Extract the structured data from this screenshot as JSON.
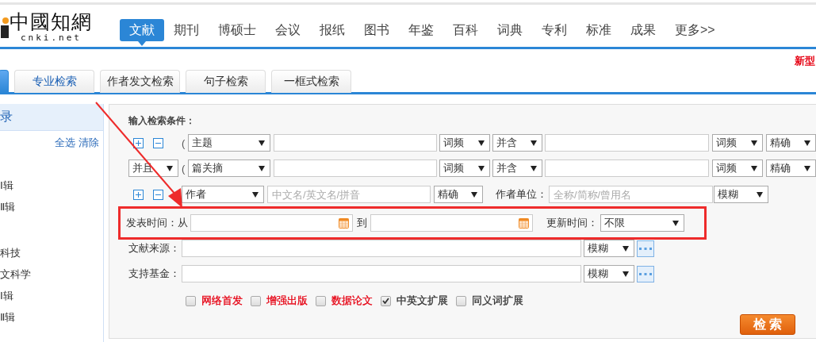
{
  "logo": {
    "text": "中國知網",
    "domain": "cnki.net"
  },
  "nav": [
    {
      "label": "文献",
      "selected": true
    },
    {
      "label": "期刊",
      "selected": false
    },
    {
      "label": "博硕士",
      "selected": false
    },
    {
      "label": "会议",
      "selected": false
    },
    {
      "label": "报纸",
      "selected": false
    },
    {
      "label": "图书",
      "selected": false
    },
    {
      "label": "年鉴",
      "selected": false
    },
    {
      "label": "百科",
      "selected": false
    },
    {
      "label": "词典",
      "selected": false
    },
    {
      "label": "专利",
      "selected": false
    },
    {
      "label": "标准",
      "selected": false
    },
    {
      "label": "成果",
      "selected": false
    },
    {
      "label": "更多>>",
      "selected": false
    }
  ],
  "top_right_link": "新型",
  "search_tabs": [
    {
      "selected": true
    },
    {
      "label": "专业检索",
      "selected": false
    },
    {
      "label": "作者发文检索",
      "selected": false
    },
    {
      "label": "句子检索",
      "selected": false
    },
    {
      "label": "一框式检索",
      "selected": false
    }
  ],
  "sidebar": {
    "title": "录",
    "actions": [
      "全选",
      "清除"
    ],
    "groups": [
      [
        "Ⅰ辑",
        "Ⅱ辑"
      ],
      [
        "科技",
        "文科学",
        "Ⅰ辑",
        "Ⅱ辑"
      ]
    ]
  },
  "form": {
    "heading": "输入检索条件：",
    "term_rows": [
      {
        "kind": "first",
        "paren": "(",
        "field": "主题",
        "freq1": "词频",
        "combine": "并含",
        "freq2": "词频",
        "match": "精确"
      },
      {
        "kind": "joined",
        "logic": "并且",
        "paren": "(",
        "field": "篇关摘",
        "freq1": "词频",
        "combine": "并含",
        "freq2": "词频",
        "match": "精确"
      }
    ],
    "author_row": {
      "field": "作者",
      "placeholder": "中文名/英文名/拼音",
      "match": "精确",
      "org_label": "作者单位：",
      "org_placeholder": "全称/简称/曾用名",
      "org_match": "模糊"
    },
    "date_row": {
      "label": "发表时间：从",
      "to": "到",
      "update_label": "更新时间：",
      "update_value": "不限"
    },
    "source_rows": [
      {
        "label": "文献来源：",
        "match": "模糊"
      },
      {
        "label": "支持基金：",
        "match": "模糊"
      }
    ],
    "options": [
      {
        "label": "网络首发",
        "checked": false,
        "color": "#e60012"
      },
      {
        "label": "增强出版",
        "checked": false,
        "color": "#e60012"
      },
      {
        "label": "数据论文",
        "checked": false,
        "color": "#e60012"
      },
      {
        "label": "中英文扩展",
        "checked": true,
        "color": "#333333"
      },
      {
        "label": "同义词扩展",
        "checked": false,
        "color": "#333333"
      }
    ],
    "search_button": "检 索"
  }
}
